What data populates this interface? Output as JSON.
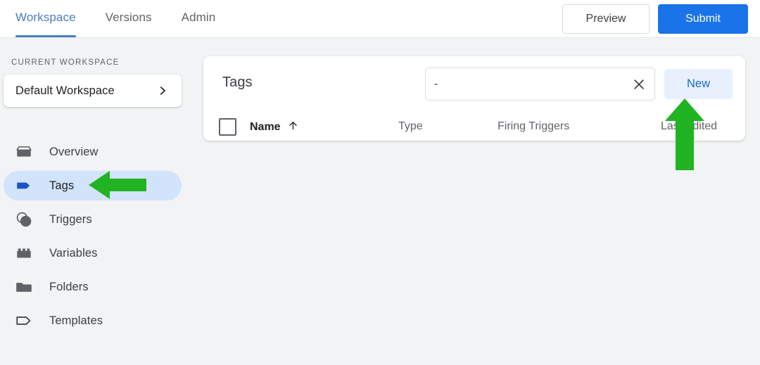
{
  "topbar": {
    "tabs": [
      {
        "label": "Workspace",
        "active": true
      },
      {
        "label": "Versions",
        "active": false
      },
      {
        "label": "Admin",
        "active": false
      }
    ],
    "preview_label": "Preview",
    "submit_label": "Submit",
    "accent_color": "#1a73e8",
    "active_tab_color": "#4b7bc4"
  },
  "sidebar": {
    "section_label": "CURRENT WORKSPACE",
    "workspace_name": "Default Workspace",
    "workspace_chevron_icon": "chevron-right-icon",
    "items": [
      {
        "label": "Overview",
        "icon": "overview-box-icon",
        "selected": false
      },
      {
        "label": "Tags",
        "icon": "tag-filled-icon",
        "selected": true
      },
      {
        "label": "Triggers",
        "icon": "triggers-venn-icon",
        "selected": false
      },
      {
        "label": "Variables",
        "icon": "variables-block-icon",
        "selected": false
      },
      {
        "label": "Folders",
        "icon": "folder-icon",
        "selected": false
      },
      {
        "label": "Templates",
        "icon": "tag-outline-icon",
        "selected": false
      }
    ],
    "selected_pill_color": "#d2e3fc",
    "selected_icon_color": "#1a56c4"
  },
  "main": {
    "card_title": "Tags",
    "search": {
      "value": "-",
      "placeholder": "",
      "clear_icon": "close-x-icon"
    },
    "new_button_label": "New",
    "table": {
      "select_all_checkbox": false,
      "columns": [
        {
          "key": "name",
          "label": "Name",
          "sort_icon": "arrow-up-icon",
          "sorted": true
        },
        {
          "key": "type",
          "label": "Type",
          "sorted": false
        },
        {
          "key": "firing",
          "label": "Firing Triggers",
          "sorted": false
        },
        {
          "key": "last",
          "label": "Last Edited",
          "sorted": false
        }
      ],
      "rows": []
    }
  },
  "annotations": {
    "color": "#22b322",
    "arrows": [
      {
        "name": "arrow-pointing-to-tags-nav",
        "direction": "left"
      },
      {
        "name": "arrow-pointing-to-new-button",
        "direction": "up"
      }
    ]
  }
}
